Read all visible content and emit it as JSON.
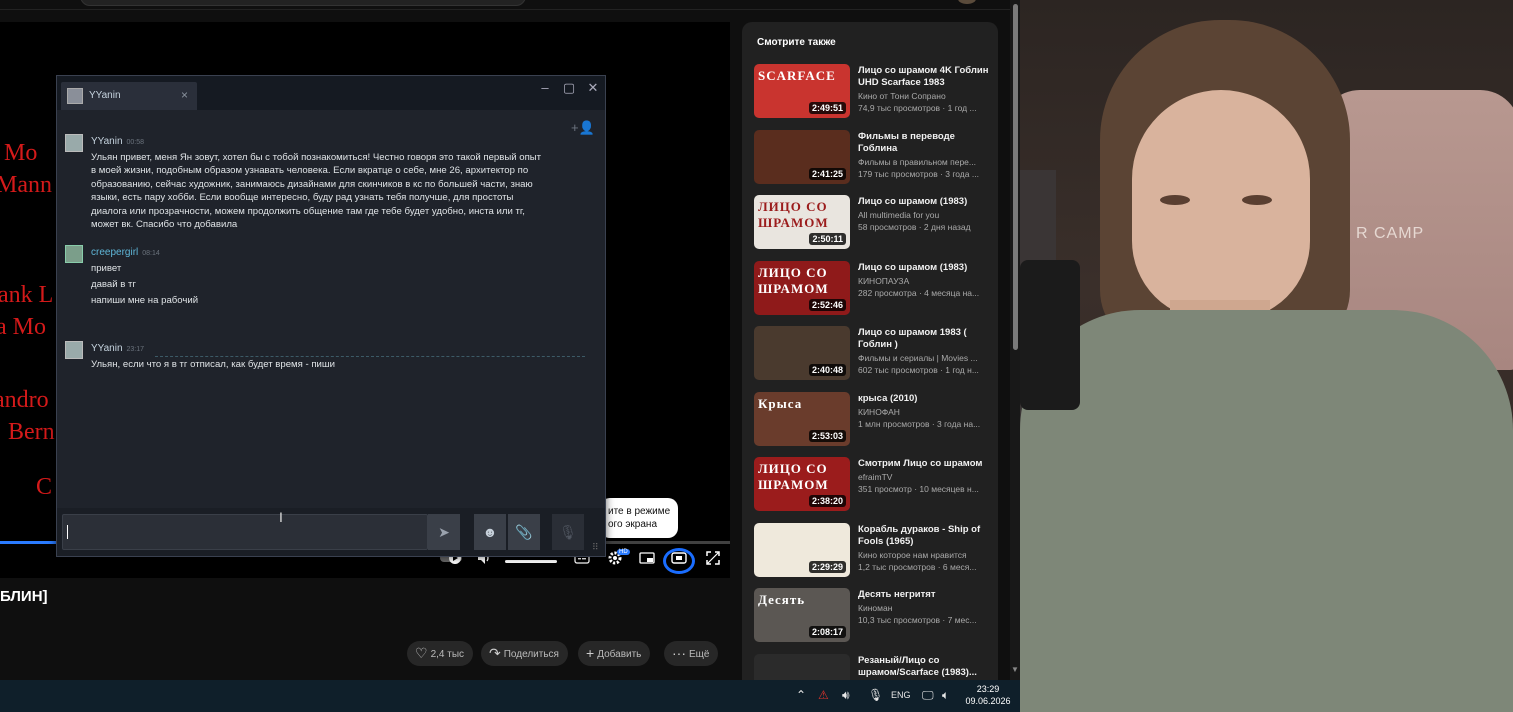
{
  "player": {
    "credits": [
      "y Mo",
      "Mann",
      "ank L",
      "a Mo",
      "andro",
      "Bern",
      "C"
    ],
    "progress_fraction": 0.077,
    "tooltip_line1": "ите в режиме",
    "tooltip_line2": "ого экрана",
    "hd_badge": "HD"
  },
  "video": {
    "title_fragment": "БЛИН]",
    "like_count": "2,4 тыс",
    "share_label": "Поделиться",
    "add_label": "Добавить",
    "more_label": "Ещё"
  },
  "sidebar": {
    "title": "Смотрите также",
    "items": [
      {
        "title": "Лицо со шрамом 4K Гоблин UHD Scarface 1983",
        "channel": "Кино от Тони Сопрано",
        "meta": "74,9 тыс просмотров · 1 год ...",
        "duration": "2:49:51",
        "thumb_label": "SCARFACE",
        "thumb_color": "#c9342f"
      },
      {
        "title": "Фильмы в переводе Гоблина",
        "channel": "Фильмы в правильном пере...",
        "meta": "179 тыс просмотров · 3 года ...",
        "duration": "2:41:25",
        "thumb_label": "",
        "thumb_color": "#5a2d1e"
      },
      {
        "title": "Лицо со шрамом (1983)",
        "channel": "All multimedia for you",
        "meta": "58 просмотров · 2 дня назад",
        "duration": "2:50:11",
        "thumb_label": "ЛИЦО СО ШРАМОМ",
        "thumb_color": "#e9e5df"
      },
      {
        "title": "Лицо со шрамом (1983)",
        "channel": "КИНОПАУЗА",
        "meta": "282 просмотра · 4 месяца на...",
        "duration": "2:52:46",
        "thumb_label": "ЛИЦО СО ШРАМОМ",
        "thumb_color": "#8f1a1a"
      },
      {
        "title": "Лицо со шрамом 1983 ( Гоблин )",
        "channel": "Фильмы и сериалы | Movies ...",
        "meta": "602 тыс просмотров · 1 год н...",
        "duration": "2:40:48",
        "thumb_label": "",
        "thumb_color": "#4a3a2e"
      },
      {
        "title": "крыса (2010)",
        "channel": "КИНОФАН",
        "meta": "1 млн просмотров · 3 года на...",
        "duration": "2:53:03",
        "thumb_label": "Крыса",
        "thumb_color": "#6a3c2c"
      },
      {
        "title": "Смотрим Лицо со шрамом",
        "channel": "efraimTV",
        "meta": "351 просмотр · 10 месяцев н...",
        "duration": "2:38:20",
        "thumb_label": "ЛИЦО СО ШРАМОМ",
        "thumb_color": "#9b1c1c"
      },
      {
        "title": "Корабль дураков - Ship of Fools (1965)",
        "channel": "Кино которое нам нравится",
        "meta": "1,2 тыс просмотров · 6 меся...",
        "duration": "2:29:29",
        "thumb_label": "",
        "thumb_color": "#efe9dc"
      },
      {
        "title": "Десять негритят",
        "channel": "Киноман",
        "meta": "10,3 тыс просмотров · 7 мес...",
        "duration": "2:08:17",
        "thumb_label": "Десять",
        "thumb_color": "#5b5753"
      },
      {
        "title": "Резаный/Лицо со шрамом/Scarface (1983)...",
        "channel": "",
        "meta": "",
        "duration": "",
        "thumb_label": "",
        "thumb_color": "#2b2b2b"
      }
    ]
  },
  "chat": {
    "tab_name": "YYanin",
    "messages": [
      {
        "author": "YYanin",
        "time": "00:58",
        "lines": [
          "Ульян привет, меня Ян зовут, хотел бы с тобой познакомиться! Честно говоря это такой первый опыт",
          "в моей жизни, подобным образом узнавать человека. Если вкратце о себе, мне 26, архитектор по",
          "образованию, сейчас художник, занимаюсь дизайнами для скинчиков в кс по большей части, знаю",
          "языки, есть пару хобби. Если вообще интересно, буду рад узнать тебя получше, для простоты",
          "диалога или прозрачности, можем продолжить общение там где тебе будет удобно, инста или тг,",
          "может вк. Спасибо что добавила"
        ]
      },
      {
        "author": "creepergirl",
        "time": "08:14",
        "lines": [
          "привет",
          "давай в тг",
          "напиши мне на рабочий"
        ]
      },
      {
        "author": "YYanin",
        "time": "23:17",
        "lines": [
          "Ульян, если что я в тг отписал, как будет время - пиши"
        ]
      }
    ],
    "input_value": ""
  },
  "webcam": {
    "chair_logo": "R CAMP"
  },
  "taskbar": {
    "lang": "ENG",
    "time": "23:29",
    "date": "09.06.2026"
  },
  "colors": {
    "accent_blue": "#2a7bff",
    "steam_bg": "#1f232b",
    "yt_bg": "#0f0f0f"
  }
}
